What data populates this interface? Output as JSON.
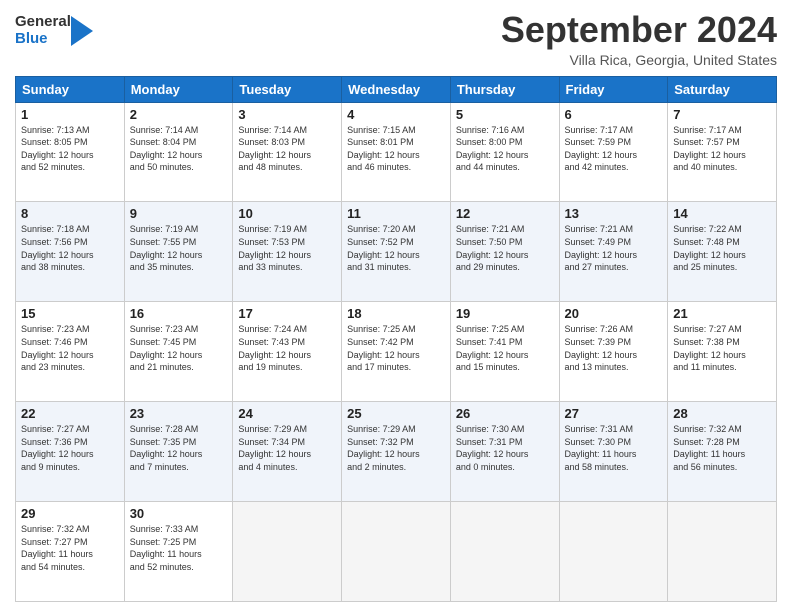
{
  "logo": {
    "line1": "General",
    "line2": "Blue"
  },
  "title": "September 2024",
  "location": "Villa Rica, Georgia, United States",
  "days_header": [
    "Sunday",
    "Monday",
    "Tuesday",
    "Wednesday",
    "Thursday",
    "Friday",
    "Saturday"
  ],
  "weeks": [
    [
      {
        "day": "1",
        "info": "Sunrise: 7:13 AM\nSunset: 8:05 PM\nDaylight: 12 hours\nand 52 minutes."
      },
      {
        "day": "2",
        "info": "Sunrise: 7:14 AM\nSunset: 8:04 PM\nDaylight: 12 hours\nand 50 minutes."
      },
      {
        "day": "3",
        "info": "Sunrise: 7:14 AM\nSunset: 8:03 PM\nDaylight: 12 hours\nand 48 minutes."
      },
      {
        "day": "4",
        "info": "Sunrise: 7:15 AM\nSunset: 8:01 PM\nDaylight: 12 hours\nand 46 minutes."
      },
      {
        "day": "5",
        "info": "Sunrise: 7:16 AM\nSunset: 8:00 PM\nDaylight: 12 hours\nand 44 minutes."
      },
      {
        "day": "6",
        "info": "Sunrise: 7:17 AM\nSunset: 7:59 PM\nDaylight: 12 hours\nand 42 minutes."
      },
      {
        "day": "7",
        "info": "Sunrise: 7:17 AM\nSunset: 7:57 PM\nDaylight: 12 hours\nand 40 minutes."
      }
    ],
    [
      {
        "day": "8",
        "info": "Sunrise: 7:18 AM\nSunset: 7:56 PM\nDaylight: 12 hours\nand 38 minutes."
      },
      {
        "day": "9",
        "info": "Sunrise: 7:19 AM\nSunset: 7:55 PM\nDaylight: 12 hours\nand 35 minutes."
      },
      {
        "day": "10",
        "info": "Sunrise: 7:19 AM\nSunset: 7:53 PM\nDaylight: 12 hours\nand 33 minutes."
      },
      {
        "day": "11",
        "info": "Sunrise: 7:20 AM\nSunset: 7:52 PM\nDaylight: 12 hours\nand 31 minutes."
      },
      {
        "day": "12",
        "info": "Sunrise: 7:21 AM\nSunset: 7:50 PM\nDaylight: 12 hours\nand 29 minutes."
      },
      {
        "day": "13",
        "info": "Sunrise: 7:21 AM\nSunset: 7:49 PM\nDaylight: 12 hours\nand 27 minutes."
      },
      {
        "day": "14",
        "info": "Sunrise: 7:22 AM\nSunset: 7:48 PM\nDaylight: 12 hours\nand 25 minutes."
      }
    ],
    [
      {
        "day": "15",
        "info": "Sunrise: 7:23 AM\nSunset: 7:46 PM\nDaylight: 12 hours\nand 23 minutes."
      },
      {
        "day": "16",
        "info": "Sunrise: 7:23 AM\nSunset: 7:45 PM\nDaylight: 12 hours\nand 21 minutes."
      },
      {
        "day": "17",
        "info": "Sunrise: 7:24 AM\nSunset: 7:43 PM\nDaylight: 12 hours\nand 19 minutes."
      },
      {
        "day": "18",
        "info": "Sunrise: 7:25 AM\nSunset: 7:42 PM\nDaylight: 12 hours\nand 17 minutes."
      },
      {
        "day": "19",
        "info": "Sunrise: 7:25 AM\nSunset: 7:41 PM\nDaylight: 12 hours\nand 15 minutes."
      },
      {
        "day": "20",
        "info": "Sunrise: 7:26 AM\nSunset: 7:39 PM\nDaylight: 12 hours\nand 13 minutes."
      },
      {
        "day": "21",
        "info": "Sunrise: 7:27 AM\nSunset: 7:38 PM\nDaylight: 12 hours\nand 11 minutes."
      }
    ],
    [
      {
        "day": "22",
        "info": "Sunrise: 7:27 AM\nSunset: 7:36 PM\nDaylight: 12 hours\nand 9 minutes."
      },
      {
        "day": "23",
        "info": "Sunrise: 7:28 AM\nSunset: 7:35 PM\nDaylight: 12 hours\nand 7 minutes."
      },
      {
        "day": "24",
        "info": "Sunrise: 7:29 AM\nSunset: 7:34 PM\nDaylight: 12 hours\nand 4 minutes."
      },
      {
        "day": "25",
        "info": "Sunrise: 7:29 AM\nSunset: 7:32 PM\nDaylight: 12 hours\nand 2 minutes."
      },
      {
        "day": "26",
        "info": "Sunrise: 7:30 AM\nSunset: 7:31 PM\nDaylight: 12 hours\nand 0 minutes."
      },
      {
        "day": "27",
        "info": "Sunrise: 7:31 AM\nSunset: 7:30 PM\nDaylight: 11 hours\nand 58 minutes."
      },
      {
        "day": "28",
        "info": "Sunrise: 7:32 AM\nSunset: 7:28 PM\nDaylight: 11 hours\nand 56 minutes."
      }
    ],
    [
      {
        "day": "29",
        "info": "Sunrise: 7:32 AM\nSunset: 7:27 PM\nDaylight: 11 hours\nand 54 minutes."
      },
      {
        "day": "30",
        "info": "Sunrise: 7:33 AM\nSunset: 7:25 PM\nDaylight: 11 hours\nand 52 minutes."
      },
      {
        "day": "",
        "info": ""
      },
      {
        "day": "",
        "info": ""
      },
      {
        "day": "",
        "info": ""
      },
      {
        "day": "",
        "info": ""
      },
      {
        "day": "",
        "info": ""
      }
    ]
  ]
}
